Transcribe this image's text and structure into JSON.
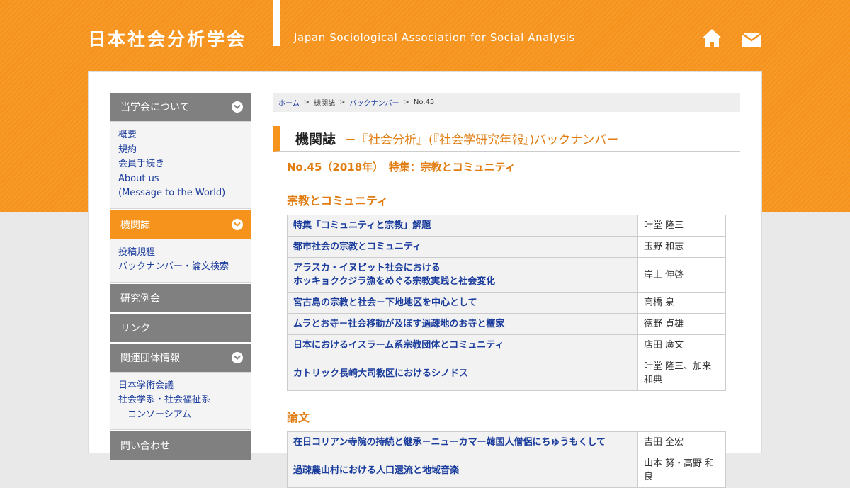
{
  "header": {
    "title": "日本社会分析学会",
    "subtitle": "Japan Sociological Association for Social Analysis"
  },
  "colors": {
    "accent": "#f6931c",
    "link": "#1a3c9c",
    "heading": "#e07c10",
    "menu": "#808080"
  },
  "sidebar": {
    "sections": [
      {
        "label": "当学会について",
        "expanded": true,
        "items": [
          {
            "label": "概要"
          },
          {
            "label": "規約"
          },
          {
            "label": "会員手続き"
          },
          {
            "label": "About us"
          },
          {
            "label": "(Message to the World)"
          }
        ]
      },
      {
        "label": "機関誌",
        "expanded": true,
        "active": true,
        "items": [
          {
            "label": "投稿規程"
          },
          {
            "label": "バックナンバー・論文検索"
          }
        ]
      },
      {
        "label": "研究例会",
        "expanded": false,
        "items": []
      },
      {
        "label": "リンク",
        "expanded": false,
        "items": []
      },
      {
        "label": "関連団体情報",
        "expanded": true,
        "items": [
          {
            "label": "日本学術会議"
          },
          {
            "label": "社会学系・社会福祉系"
          },
          {
            "label": "コンソーシアム"
          }
        ]
      },
      {
        "label": "問い合わせ",
        "expanded": false,
        "items": []
      }
    ]
  },
  "breadcrumb": [
    "ホーム",
    "機関誌",
    "バックナンバー",
    "No.45"
  ],
  "page": {
    "heading": "機関誌",
    "heading_sub": "－『社会分析』(『社会学研究年報』)バックナンバー",
    "issue": "No.45（2018年）　特集：宗教とコミュニティ"
  },
  "sections": [
    {
      "title": "宗教とコミュニティ",
      "articles": [
        {
          "title": "特集「コミュニティと宗教」解題",
          "author": "叶堂 隆三"
        },
        {
          "title": "都市社会の宗教とコミュニティ",
          "author": "玉野 和志"
        },
        {
          "title": "アラスカ・イヌピット社会における",
          "title2": "ホッキョククジラ漁をめぐる宗教実践と社会変化",
          "author": "岸上 伸啓"
        },
        {
          "title": "宮古島の宗教と社会－下地地区を中心として",
          "author": "高橋 泉"
        },
        {
          "title": "ムラとお寺－社会移動が及ぼす過疎地のお寺と檀家",
          "author": "徳野 貞雄"
        },
        {
          "title": "日本におけるイスラーム系宗教団体とコミュニティ",
          "author": "店田 廣文"
        },
        {
          "title": "カトリック長崎大司教区におけるシノドス",
          "author": "叶堂 隆三、加来",
          "author2": "和典"
        }
      ]
    },
    {
      "title": "論文",
      "articles": [
        {
          "title": "在日コリアン寺院の持続と継承－ニューカマー韓国人僧侶にちゅうもくして",
          "author": "吉田 全宏"
        },
        {
          "title": "過疎農山村における人口還流と地域音楽",
          "author": "山本 努・高野 和良"
        }
      ]
    }
  ]
}
